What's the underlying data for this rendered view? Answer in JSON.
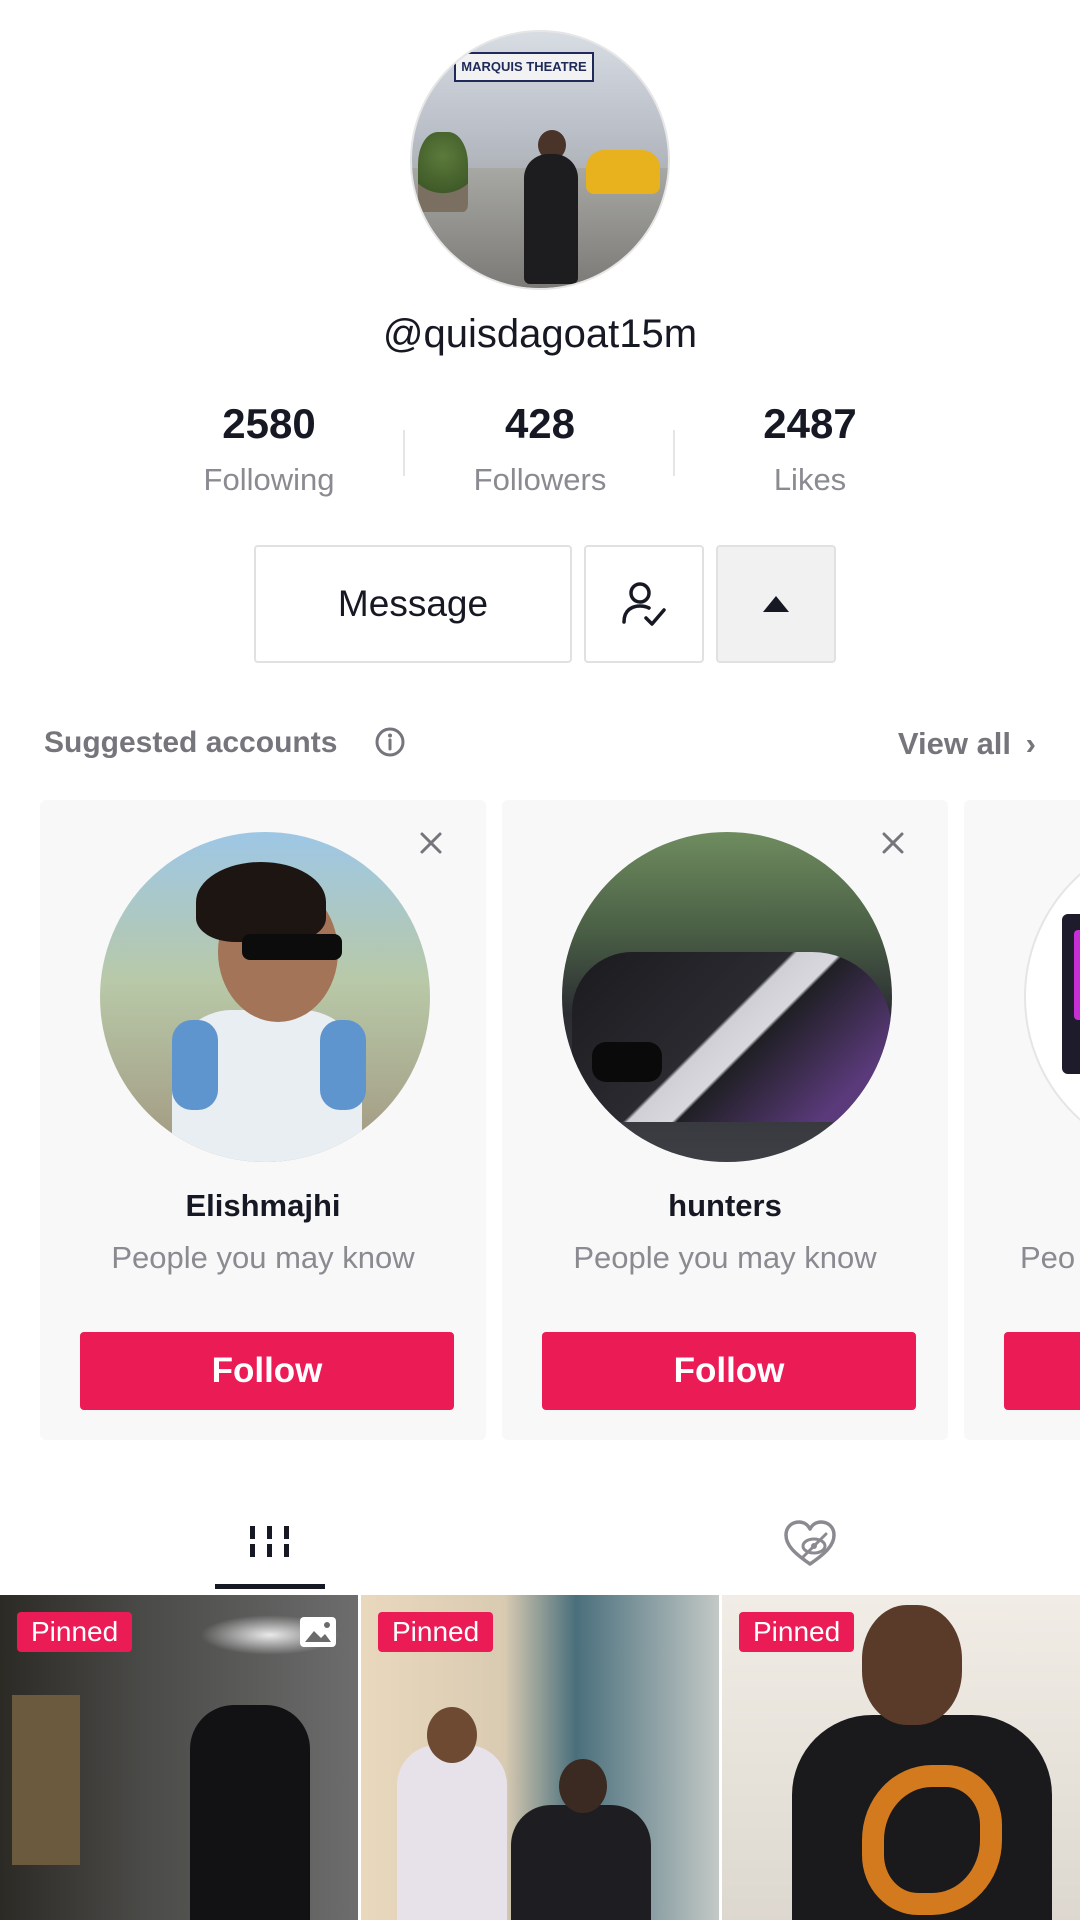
{
  "profile": {
    "username": "@quisdagoat15m",
    "avatar_sign": "MARQUIS THEATRE",
    "stats": [
      {
        "value": "2580",
        "label": "Following"
      },
      {
        "value": "428",
        "label": "Followers"
      },
      {
        "value": "2487",
        "label": "Likes"
      }
    ],
    "actions": {
      "message_label": "Message",
      "friends_icon": "person-check-icon",
      "more_icon": "caret-up-icon"
    }
  },
  "suggested": {
    "title": "Suggested accounts",
    "info_icon": "info-icon",
    "view_all": "View all",
    "cards": [
      {
        "name": "Elishmajhi",
        "reason": "People you may know",
        "follow_label": "Follow"
      },
      {
        "name": "hunters",
        "reason": "People you may know",
        "follow_label": "Follow"
      },
      {
        "name": "",
        "reason": "Peo",
        "follow_label": ""
      }
    ]
  },
  "tabs": {
    "videos_icon": "grid-bars-icon",
    "liked_icon": "hidden-heart-icon"
  },
  "grid": {
    "tiles": [
      {
        "badge": "Pinned",
        "photo_mode": true
      },
      {
        "badge": "Pinned",
        "photo_mode": false
      },
      {
        "badge": "Pinned",
        "photo_mode": false
      }
    ]
  },
  "colors": {
    "accent": "#ea1b55",
    "text_primary": "#161823",
    "text_secondary": "#8a8b91"
  }
}
